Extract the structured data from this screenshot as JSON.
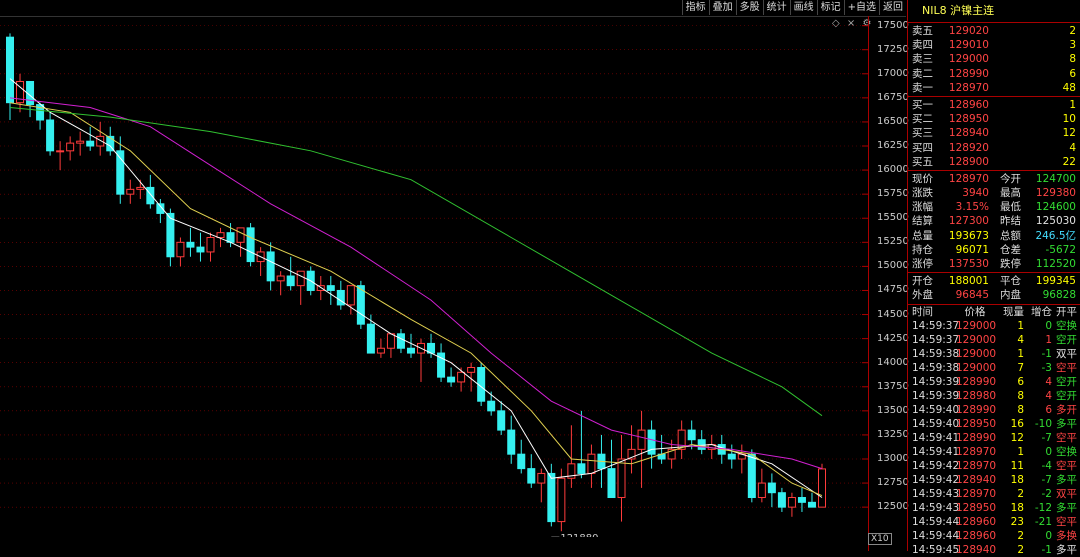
{
  "toolbar": {
    "buttons": [
      "指标",
      "叠加",
      "多股",
      "统计",
      "画线",
      "标记",
      "+自选",
      "返回"
    ],
    "icons": [
      "◇",
      "×",
      "⚙"
    ]
  },
  "chart": {
    "y_labels": [
      "17500",
      "17250",
      "17000",
      "16750",
      "16500",
      "16250",
      "16000",
      "15750",
      "15500",
      "15250",
      "15000",
      "14750",
      "14500",
      "14250",
      "14000",
      "13750",
      "13500",
      "13250",
      "13000",
      "12750",
      "12500"
    ],
    "low_marker": "121880",
    "zoom_label": "X10",
    "colors": {
      "up": "#ff3b3b",
      "down": "#35f0f0",
      "ma_short": "#ffffff",
      "ma_mid": "#e0d050",
      "ma_long1": "#d020d0",
      "ma_long2": "#30c030"
    }
  },
  "chart_data": {
    "type": "candlestick",
    "ylim": [
      12190,
      17600
    ],
    "low_label": 12188,
    "candles": [
      [
        17380,
        17420,
        16520,
        16700
      ],
      [
        16700,
        17000,
        16600,
        16920
      ],
      [
        16920,
        16920,
        16550,
        16680
      ],
      [
        16680,
        16700,
        16420,
        16520
      ],
      [
        16520,
        16600,
        16150,
        16200
      ],
      [
        16200,
        16300,
        16000,
        16200
      ],
      [
        16200,
        16350,
        16100,
        16280
      ],
      [
        16280,
        16400,
        16150,
        16300
      ],
      [
        16300,
        16450,
        16200,
        16250
      ],
      [
        16250,
        16500,
        16150,
        16350
      ],
      [
        16350,
        16450,
        16150,
        16200
      ],
      [
        16200,
        16350,
        15650,
        15750
      ],
      [
        15750,
        15900,
        15650,
        15800
      ],
      [
        15800,
        15900,
        15700,
        15820
      ],
      [
        15820,
        15950,
        15600,
        15650
      ],
      [
        15650,
        15700,
        15450,
        15550
      ],
      [
        15550,
        15600,
        15000,
        15100
      ],
      [
        15100,
        15300,
        15000,
        15250
      ],
      [
        15250,
        15400,
        15100,
        15200
      ],
      [
        15200,
        15350,
        15050,
        15150
      ],
      [
        15150,
        15350,
        15050,
        15300
      ],
      [
        15300,
        15400,
        15200,
        15350
      ],
      [
        15350,
        15450,
        15200,
        15250
      ],
      [
        15250,
        15400,
        15100,
        15400
      ],
      [
        15400,
        15450,
        15000,
        15050
      ],
      [
        15050,
        15200,
        14900,
        15150
      ],
      [
        15150,
        15250,
        14750,
        14850
      ],
      [
        14850,
        14950,
        14700,
        14900
      ],
      [
        14900,
        15100,
        14750,
        14800
      ],
      [
        14800,
        14950,
        14600,
        14950
      ],
      [
        14950,
        15000,
        14700,
        14750
      ],
      [
        14750,
        14900,
        14650,
        14800
      ],
      [
        14800,
        14900,
        14600,
        14750
      ],
      [
        14750,
        14850,
        14550,
        14600
      ],
      [
        14600,
        14800,
        14500,
        14800
      ],
      [
        14800,
        14850,
        14350,
        14400
      ],
      [
        14400,
        14500,
        14100,
        14100
      ],
      [
        14100,
        14250,
        14050,
        14150
      ],
      [
        14150,
        14300,
        14050,
        14300
      ],
      [
        14300,
        14350,
        14100,
        14150
      ],
      [
        14150,
        14300,
        14050,
        14100
      ],
      [
        14100,
        14250,
        13800,
        14200
      ],
      [
        14200,
        14300,
        14050,
        14100
      ],
      [
        14100,
        14200,
        13800,
        13850
      ],
      [
        13850,
        13950,
        13750,
        13800
      ],
      [
        13800,
        13950,
        13700,
        13900
      ],
      [
        13900,
        14000,
        13700,
        13950
      ],
      [
        13950,
        14000,
        13550,
        13600
      ],
      [
        13600,
        13700,
        13450,
        13500
      ],
      [
        13500,
        13600,
        13250,
        13300
      ],
      [
        13300,
        13450,
        12950,
        13050
      ],
      [
        13050,
        13200,
        12850,
        12900
      ],
      [
        12900,
        13050,
        12700,
        12750
      ],
      [
        12750,
        12900,
        12550,
        12850
      ],
      [
        12850,
        12950,
        12300,
        12350
      ],
      [
        12350,
        12900,
        12250,
        12800
      ],
      [
        12800,
        13350,
        12700,
        12950
      ],
      [
        12950,
        13500,
        12800,
        12850
      ],
      [
        12850,
        13150,
        12700,
        13050
      ],
      [
        13050,
        13250,
        12700,
        12900
      ],
      [
        12900,
        13200,
        12700,
        12600
      ],
      [
        12600,
        13250,
        12350,
        13000
      ],
      [
        13000,
        13350,
        12850,
        13100
      ],
      [
        13100,
        13500,
        12700,
        13300
      ],
      [
        13300,
        13400,
        12900,
        13050
      ],
      [
        13050,
        13250,
        12950,
        13000
      ],
      [
        13000,
        13200,
        12900,
        13100
      ],
      [
        13100,
        13400,
        13000,
        13300
      ],
      [
        13300,
        13400,
        13100,
        13200
      ],
      [
        13200,
        13300,
        13050,
        13100
      ],
      [
        13100,
        13250,
        13000,
        13150
      ],
      [
        13150,
        13250,
        12950,
        13050
      ],
      [
        13050,
        13150,
        12900,
        13000
      ],
      [
        13000,
        13150,
        12850,
        13050
      ],
      [
        13050,
        13100,
        12550,
        12600
      ],
      [
        12600,
        12900,
        12550,
        12750
      ],
      [
        12750,
        12850,
        12500,
        12650
      ],
      [
        12650,
        12700,
        12450,
        12500
      ],
      [
        12500,
        12650,
        12400,
        12600
      ],
      [
        12600,
        12700,
        12450,
        12550
      ],
      [
        12550,
        12650,
        12500,
        12500
      ],
      [
        12500,
        12950,
        12500,
        12897
      ]
    ],
    "ma": {
      "ma_short": [
        [
          0,
          16950
        ],
        [
          4,
          16600
        ],
        [
          10,
          16250
        ],
        [
          16,
          15500
        ],
        [
          22,
          15250
        ],
        [
          30,
          14850
        ],
        [
          38,
          14300
        ],
        [
          44,
          14000
        ],
        [
          50,
          13500
        ],
        [
          54,
          12800
        ],
        [
          58,
          12850
        ],
        [
          64,
          13100
        ],
        [
          70,
          13150
        ],
        [
          76,
          12950
        ],
        [
          81,
          12600
        ]
      ],
      "ma_mid": [
        [
          0,
          16700
        ],
        [
          6,
          16600
        ],
        [
          12,
          16200
        ],
        [
          18,
          15600
        ],
        [
          24,
          15300
        ],
        [
          32,
          14950
        ],
        [
          40,
          14450
        ],
        [
          46,
          14100
        ],
        [
          52,
          13500
        ],
        [
          56,
          13000
        ],
        [
          62,
          12950
        ],
        [
          68,
          13150
        ],
        [
          74,
          13050
        ],
        [
          78,
          12750
        ],
        [
          81,
          12620
        ]
      ],
      "ma_long1": [
        [
          0,
          16750
        ],
        [
          8,
          16650
        ],
        [
          14,
          16450
        ],
        [
          20,
          16050
        ],
        [
          26,
          15650
        ],
        [
          34,
          15200
        ],
        [
          42,
          14650
        ],
        [
          48,
          14100
        ],
        [
          54,
          13600
        ],
        [
          60,
          13300
        ],
        [
          66,
          13150
        ],
        [
          72,
          13100
        ],
        [
          78,
          13000
        ],
        [
          81,
          12900
        ]
      ],
      "ma_long2": [
        [
          0,
          16650
        ],
        [
          10,
          16550
        ],
        [
          20,
          16400
        ],
        [
          30,
          16200
        ],
        [
          40,
          15900
        ],
        [
          50,
          15300
        ],
        [
          60,
          14700
        ],
        [
          70,
          14100
        ],
        [
          77,
          13750
        ],
        [
          81,
          13450
        ]
      ]
    }
  },
  "panel": {
    "title": "NIL8 沪镍主连",
    "asks": [
      {
        "label": "卖五",
        "price": "129020",
        "vol": "2"
      },
      {
        "label": "卖四",
        "price": "129010",
        "vol": "3"
      },
      {
        "label": "卖三",
        "price": "129000",
        "vol": "8"
      },
      {
        "label": "卖二",
        "price": "128990",
        "vol": "6"
      },
      {
        "label": "卖一",
        "price": "128970",
        "vol": "48"
      }
    ],
    "bids": [
      {
        "label": "买一",
        "price": "128960",
        "vol": "1"
      },
      {
        "label": "买二",
        "price": "128950",
        "vol": "10"
      },
      {
        "label": "买三",
        "price": "128940",
        "vol": "12"
      },
      {
        "label": "买四",
        "price": "128920",
        "vol": "4"
      },
      {
        "label": "买五",
        "price": "128900",
        "vol": "22"
      }
    ],
    "stats": [
      {
        "l1": "现价",
        "v1": "128970",
        "c1": "red",
        "l2": "今开",
        "v2": "124700",
        "c2": "green"
      },
      {
        "l1": "涨跌",
        "v1": "3940",
        "c1": "red",
        "l2": "最高",
        "v2": "129380",
        "c2": "red"
      },
      {
        "l1": "涨幅",
        "v1": "3.15%",
        "c1": "red",
        "l2": "最低",
        "v2": "124600",
        "c2": "green"
      },
      {
        "l1": "结算",
        "v1": "127300",
        "c1": "red",
        "l2": "昨结",
        "v2": "125030",
        "c2": "white"
      },
      {
        "l1": "总量",
        "v1": "193673",
        "c1": "yellow",
        "l2": "总额",
        "v2": "246.5亿",
        "c2": "cyan"
      },
      {
        "l1": "持仓",
        "v1": "96071",
        "c1": "yellow",
        "l2": "仓差",
        "v2": "-5672",
        "c2": "green"
      },
      {
        "l1": "涨停",
        "v1": "137530",
        "c1": "red",
        "l2": "跌停",
        "v2": "112520",
        "c2": "green"
      }
    ],
    "flow": [
      {
        "l1": "开仓",
        "v1": "188001",
        "c1": "yellow",
        "l2": "平仓",
        "v2": "199345",
        "c2": "yellow"
      },
      {
        "l1": "外盘",
        "v1": "96845",
        "c1": "red",
        "l2": "内盘",
        "v2": "96828",
        "c2": "green"
      }
    ],
    "trade_headers": [
      "时间",
      "价格",
      "现量",
      "增仓",
      "开平"
    ],
    "trades": [
      {
        "time": "14:59:37",
        "price": "129000",
        "vol": "1",
        "chg": "0",
        "type": "空换",
        "pc": "red",
        "tc": "green"
      },
      {
        "time": "14:59:37",
        "price": "129000",
        "vol": "4",
        "chg": "1",
        "type": "空开",
        "pc": "red",
        "tc": "green"
      },
      {
        "time": "14:59:38",
        "price": "129000",
        "vol": "1",
        "chg": "-1",
        "type": "双平",
        "pc": "red",
        "tc": "white"
      },
      {
        "time": "14:59:38",
        "price": "129000",
        "vol": "7",
        "chg": "-3",
        "type": "空平",
        "pc": "red",
        "tc": "red"
      },
      {
        "time": "14:59:39",
        "price": "128990",
        "vol": "6",
        "chg": "4",
        "type": "空开",
        "pc": "red",
        "tc": "green"
      },
      {
        "time": "14:59:39",
        "price": "128980",
        "vol": "8",
        "chg": "4",
        "type": "空开",
        "pc": "red",
        "tc": "green"
      },
      {
        "time": "14:59:40",
        "price": "128990",
        "vol": "8",
        "chg": "6",
        "type": "多开",
        "pc": "red",
        "tc": "red"
      },
      {
        "time": "14:59:40",
        "price": "128950",
        "vol": "16",
        "chg": "-10",
        "type": "多平",
        "pc": "red",
        "tc": "green"
      },
      {
        "time": "14:59:41",
        "price": "128990",
        "vol": "12",
        "chg": "-7",
        "type": "空平",
        "pc": "red",
        "tc": "red"
      },
      {
        "time": "14:59:41",
        "price": "128970",
        "vol": "1",
        "chg": "0",
        "type": "空换",
        "pc": "red",
        "tc": "green"
      },
      {
        "time": "14:59:42",
        "price": "128970",
        "vol": "11",
        "chg": "-4",
        "type": "空平",
        "pc": "red",
        "tc": "red"
      },
      {
        "time": "14:59:42",
        "price": "128940",
        "vol": "18",
        "chg": "-7",
        "type": "多平",
        "pc": "red",
        "tc": "green"
      },
      {
        "time": "14:59:43",
        "price": "128970",
        "vol": "2",
        "chg": "-2",
        "type": "双平",
        "pc": "red",
        "tc": "red"
      },
      {
        "time": "14:59:43",
        "price": "128950",
        "vol": "18",
        "chg": "-12",
        "type": "多平",
        "pc": "red",
        "tc": "green"
      },
      {
        "time": "14:59:44",
        "price": "128960",
        "vol": "23",
        "chg": "-21",
        "type": "空平",
        "pc": "red",
        "tc": "red"
      },
      {
        "time": "14:59:44",
        "price": "128960",
        "vol": "2",
        "chg": "0",
        "type": "多换",
        "pc": "red",
        "tc": "red"
      },
      {
        "time": "14:59:45",
        "price": "128940",
        "vol": "2",
        "chg": "-1",
        "type": "多平",
        "pc": "red",
        "tc": "white"
      }
    ]
  }
}
